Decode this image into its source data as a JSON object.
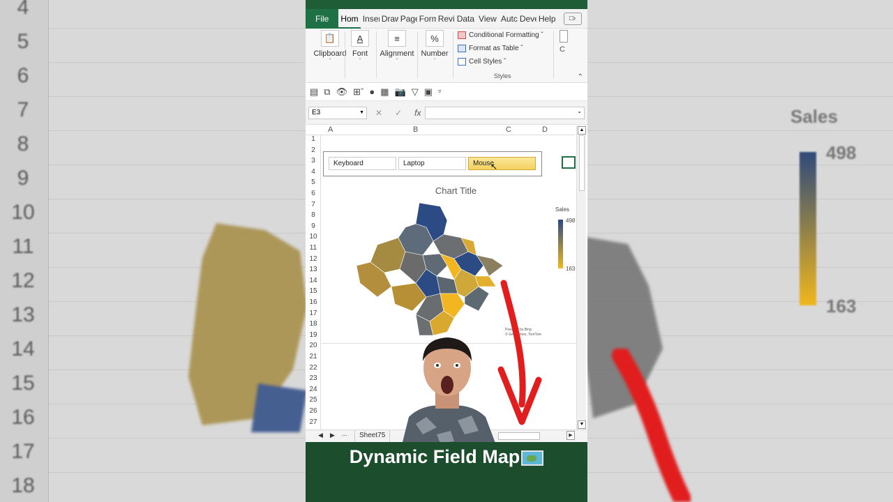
{
  "app": {
    "tabs": [
      "File",
      "Hom",
      "Inser",
      "Draw",
      "Page",
      "Form",
      "Revie",
      "Data",
      "View",
      "Autc",
      "Deve",
      "Help"
    ],
    "active_tab": "Hom"
  },
  "ribbon": {
    "groups": [
      {
        "label": "Clipboard",
        "icon": "clipboard-icon"
      },
      {
        "label": "Font",
        "icon": "font-icon"
      },
      {
        "label": "Alignment",
        "icon": "alignment-icon"
      },
      {
        "label": "Number",
        "icon": "percent-icon"
      }
    ],
    "styles": {
      "conditional_formatting": "Conditional Formatting",
      "format_as_table": "Format as Table",
      "cell_styles": "Cell Styles",
      "group_label": "Styles"
    },
    "cells_label_c": "C"
  },
  "formula_bar": {
    "name_box": "E3",
    "fx_label": "fx",
    "value": ""
  },
  "sheet": {
    "columns": [
      "A",
      "B",
      "C",
      "D"
    ],
    "rows": [
      "1",
      "2",
      "3",
      "4",
      "5",
      "6",
      "7",
      "8",
      "9",
      "10",
      "11",
      "12",
      "13",
      "14",
      "15",
      "16",
      "17",
      "18",
      "19",
      "20",
      "21",
      "22",
      "23",
      "24",
      "25",
      "26",
      "27"
    ],
    "slicer": {
      "items": [
        "Keyboard",
        "Laptop",
        "Mouse"
      ],
      "selected": "Mouse"
    },
    "chart": {
      "title": "Chart Title",
      "legend_title": "Sales",
      "legend_max": "498",
      "legend_min": "163",
      "attribution_line1": "Powered by Bing",
      "attribution_line2": "© GeoNames, TomTom"
    },
    "sheet_tab": "Sheet75",
    "nav_ellipsis": "..."
  },
  "background": {
    "row_numbers": [
      "4",
      "5",
      "6",
      "7",
      "8",
      "9",
      "10",
      "11",
      "12",
      "13",
      "14",
      "15",
      "16",
      "17",
      "18"
    ],
    "legend_title": "Sales",
    "legend_max": "498",
    "legend_min": "163",
    "legend_colors": [
      "#2c4a84",
      "#f2b620"
    ]
  },
  "banner": {
    "text": "Dynamic Field Map",
    "icon": "world-map-icon"
  },
  "colors": {
    "excel_green": "#1e7145",
    "banner_green": "#1c4d2c",
    "map_blue": "#2c4a84",
    "map_yellow": "#f2b620",
    "arrow_red": "#e11d1d"
  }
}
